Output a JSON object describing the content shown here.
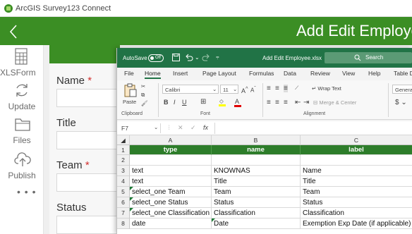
{
  "window": {
    "app_title": "ArcGIS Survey123 Connect"
  },
  "header": {
    "back_icon": "chevron-left-icon",
    "title": "Add Edit Employee"
  },
  "sidebar": {
    "items": [
      {
        "label": "XLSForm",
        "icon": "spreadsheet-icon"
      },
      {
        "label": "Update",
        "icon": "refresh-icon"
      },
      {
        "label": "Files",
        "icon": "folder-icon"
      },
      {
        "label": "Publish",
        "icon": "cloud-upload-icon"
      }
    ],
    "more": "• • •"
  },
  "form": {
    "fields": [
      {
        "label": "Name",
        "required": true
      },
      {
        "label": "Title",
        "required": false
      },
      {
        "label": "Team",
        "required": true
      },
      {
        "label": "Status",
        "required": false
      }
    ],
    "required_mark": "*"
  },
  "excel": {
    "autosave_label": "AutoSave",
    "autosave_state": "Off",
    "file_name": "Add Edit Employee.xlsx",
    "file_chevron": "⌄",
    "search_placeholder": "Search",
    "menu": [
      "File",
      "Home",
      "Insert",
      "Page Layout",
      "Formulas",
      "Data",
      "Review",
      "View",
      "Help",
      "Table D"
    ],
    "active_menu": "Home",
    "ribbon": {
      "paste_label": "Paste",
      "font_name": "Calibri",
      "font_size": "11",
      "wrap_text": "Wrap Text",
      "merge_center": "Merge & Center",
      "number_format": "Genera",
      "groups": [
        "Clipboard",
        "Font",
        "Alignment"
      ]
    },
    "name_box": "F7",
    "fx_label": "fx",
    "columns": [
      "A",
      "B",
      "C"
    ],
    "rows": [
      {
        "num": "1",
        "cells": [
          "type",
          "name",
          "label"
        ],
        "header": true
      },
      {
        "num": "2",
        "cells": [
          "",
          "",
          ""
        ]
      },
      {
        "num": "3",
        "cells": [
          "text",
          "KNOWNAS",
          "Name"
        ]
      },
      {
        "num": "4",
        "cells": [
          "text",
          "Title",
          "Title"
        ]
      },
      {
        "num": "5",
        "cells": [
          "select_one Team",
          "Team",
          "Team"
        ]
      },
      {
        "num": "6",
        "cells": [
          "select_one Status",
          "Status",
          "Status"
        ]
      },
      {
        "num": "7",
        "cells": [
          "select_one Classification",
          "Classification",
          "Classification"
        ]
      },
      {
        "num": "8",
        "cells": [
          "date",
          "Date",
          "Exemption Exp Date (if applicable)"
        ]
      }
    ],
    "colors": {
      "header_fill": "#2d7d2a",
      "title_bar": "#217346"
    }
  },
  "colors": {
    "accent": "#3b8e24",
    "required": "#d2302f"
  }
}
